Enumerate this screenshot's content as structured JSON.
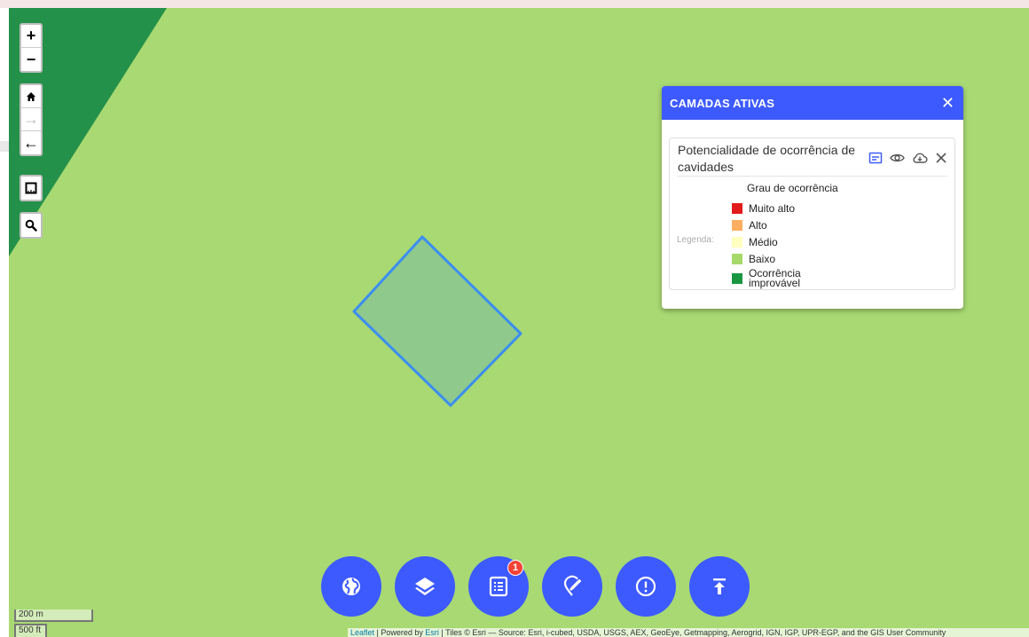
{
  "map": {
    "colors": {
      "background": "#a8d972",
      "dark_zone": "#24914a",
      "polygon_fill": "#8fc98c",
      "polygon_stroke": "#3b8ef0"
    }
  },
  "controls": {
    "zoom_in": "+",
    "zoom_out": "−",
    "home": "home-icon",
    "forward": "→",
    "back": "←",
    "measure": "ruler-icon",
    "search": "search-icon"
  },
  "active_layers": {
    "title": "CAMADAS ATIVAS",
    "close_label": "✕",
    "layer": {
      "name": "Potencialidade de ocorrência de cavidades",
      "actions": [
        "legend-icon",
        "eye-icon",
        "cloud-download-icon",
        "close-icon"
      ],
      "legend_label": "Legenda:",
      "legend_title": "Grau de ocorrência",
      "legend_items": [
        {
          "label": "Muito alto",
          "color": "#e31a1c"
        },
        {
          "label": "Alto",
          "color": "#fdae61"
        },
        {
          "label": "Médio",
          "color": "#ffffbf"
        },
        {
          "label": "Baixo",
          "color": "#a6d96a"
        },
        {
          "label": "Ocorrência improvável",
          "color": "#1a9641"
        }
      ]
    }
  },
  "fab_buttons": [
    {
      "icon": "globe-icon"
    },
    {
      "icon": "layers-icon"
    },
    {
      "icon": "list-icon",
      "badge": "1"
    },
    {
      "icon": "pin-edit-icon"
    },
    {
      "icon": "alert-icon"
    },
    {
      "icon": "upload-icon"
    }
  ],
  "scale": {
    "metric": "200 m",
    "imperial": "500 ft"
  },
  "attribution": {
    "leaflet": "Leaflet",
    "powered": " | Powered by ",
    "esri": "Esri",
    "rest": " | Tiles © Esri — Source: Esri, i-cubed, USDA, USGS, AEX, GeoEye, Getmapping, Aerogrid, IGN, IGP, UPR-EGP, and the GIS User Community"
  }
}
